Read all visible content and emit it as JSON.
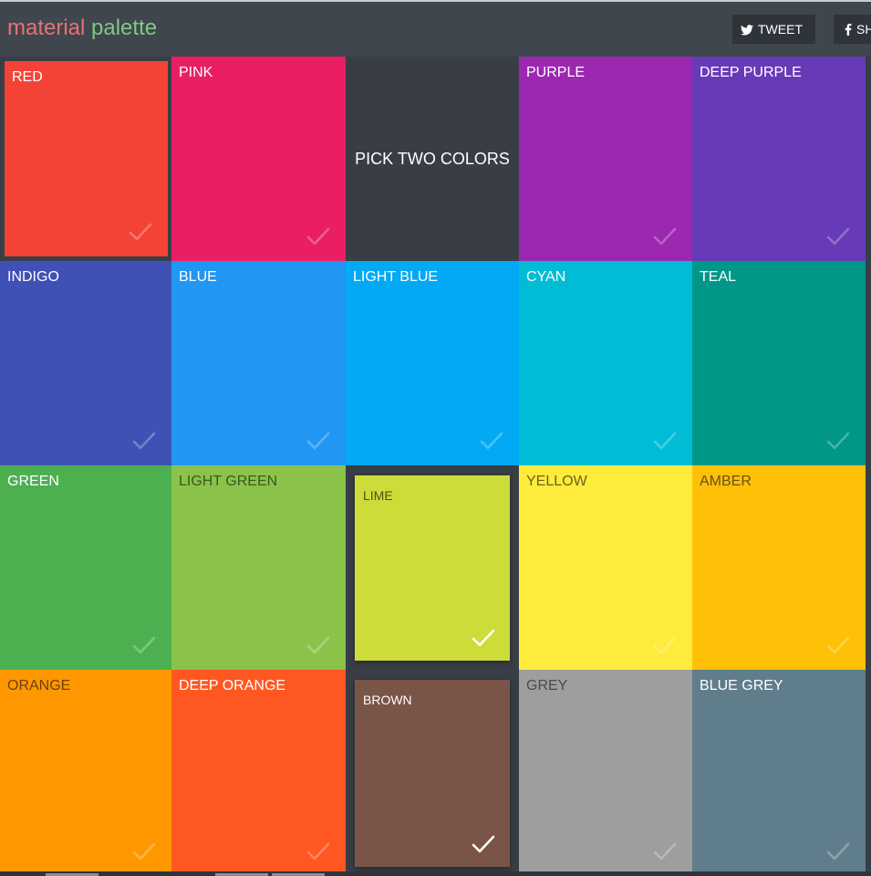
{
  "header": {
    "logo_word1": "material",
    "logo_word2": "palette",
    "tweet_label": "TWEET",
    "share_label": "SH"
  },
  "colors": {
    "logo_word1": "#e57373",
    "logo_word2": "#81c784",
    "background": "#393e46"
  },
  "info": {
    "headline": "PICK TWO COLORS"
  },
  "tiles": [
    {
      "label": "RED",
      "color": "#f44336",
      "text": "#ffffff",
      "selected": false
    },
    {
      "label": "PINK",
      "color": "#e91e63",
      "text": "#ffffff",
      "selected": false
    },
    {
      "label": "PURPLE",
      "color": "#9c27b0",
      "text": "#ffffff",
      "selected": false
    },
    {
      "label": "DEEP PURPLE",
      "color": "#673ab7",
      "text": "#ffffff",
      "selected": false
    },
    {
      "label": "INDIGO",
      "color": "#3f51b5",
      "text": "#ffffff",
      "selected": false
    },
    {
      "label": "BLUE",
      "color": "#2196f3",
      "text": "#ffffff",
      "selected": false
    },
    {
      "label": "LIGHT BLUE",
      "color": "#03a9f4",
      "text": "#ffffff",
      "selected": false
    },
    {
      "label": "CYAN",
      "color": "#00bcd4",
      "text": "#ffffff",
      "selected": false
    },
    {
      "label": "TEAL",
      "color": "#009688",
      "text": "#ffffff",
      "selected": false
    },
    {
      "label": "GREEN",
      "color": "#4caf50",
      "text": "#ffffff",
      "selected": false
    },
    {
      "label": "LIGHT GREEN",
      "color": "#8bc34a",
      "text": "#3a5a1c",
      "selected": false
    },
    {
      "label": "LIME",
      "color": "#cddc39",
      "text": "#4d5314",
      "selected": true
    },
    {
      "label": "YELLOW",
      "color": "#ffeb3b",
      "text": "#6a621a",
      "selected": false
    },
    {
      "label": "AMBER",
      "color": "#ffc107",
      "text": "#6a5010",
      "selected": false
    },
    {
      "label": "ORANGE",
      "color": "#ff9800",
      "text": "#6b4210",
      "selected": false
    },
    {
      "label": "DEEP ORANGE",
      "color": "#ff5722",
      "text": "#ffffff",
      "selected": false
    },
    {
      "label": "BROWN",
      "color": "#795548",
      "text": "#ffffff",
      "selected": true
    },
    {
      "label": "GREY",
      "color": "#9e9e9e",
      "text": "#4a4a4a",
      "selected": false
    },
    {
      "label": "BLUE GREY",
      "color": "#607d8b",
      "text": "#ffffff",
      "selected": false
    }
  ]
}
